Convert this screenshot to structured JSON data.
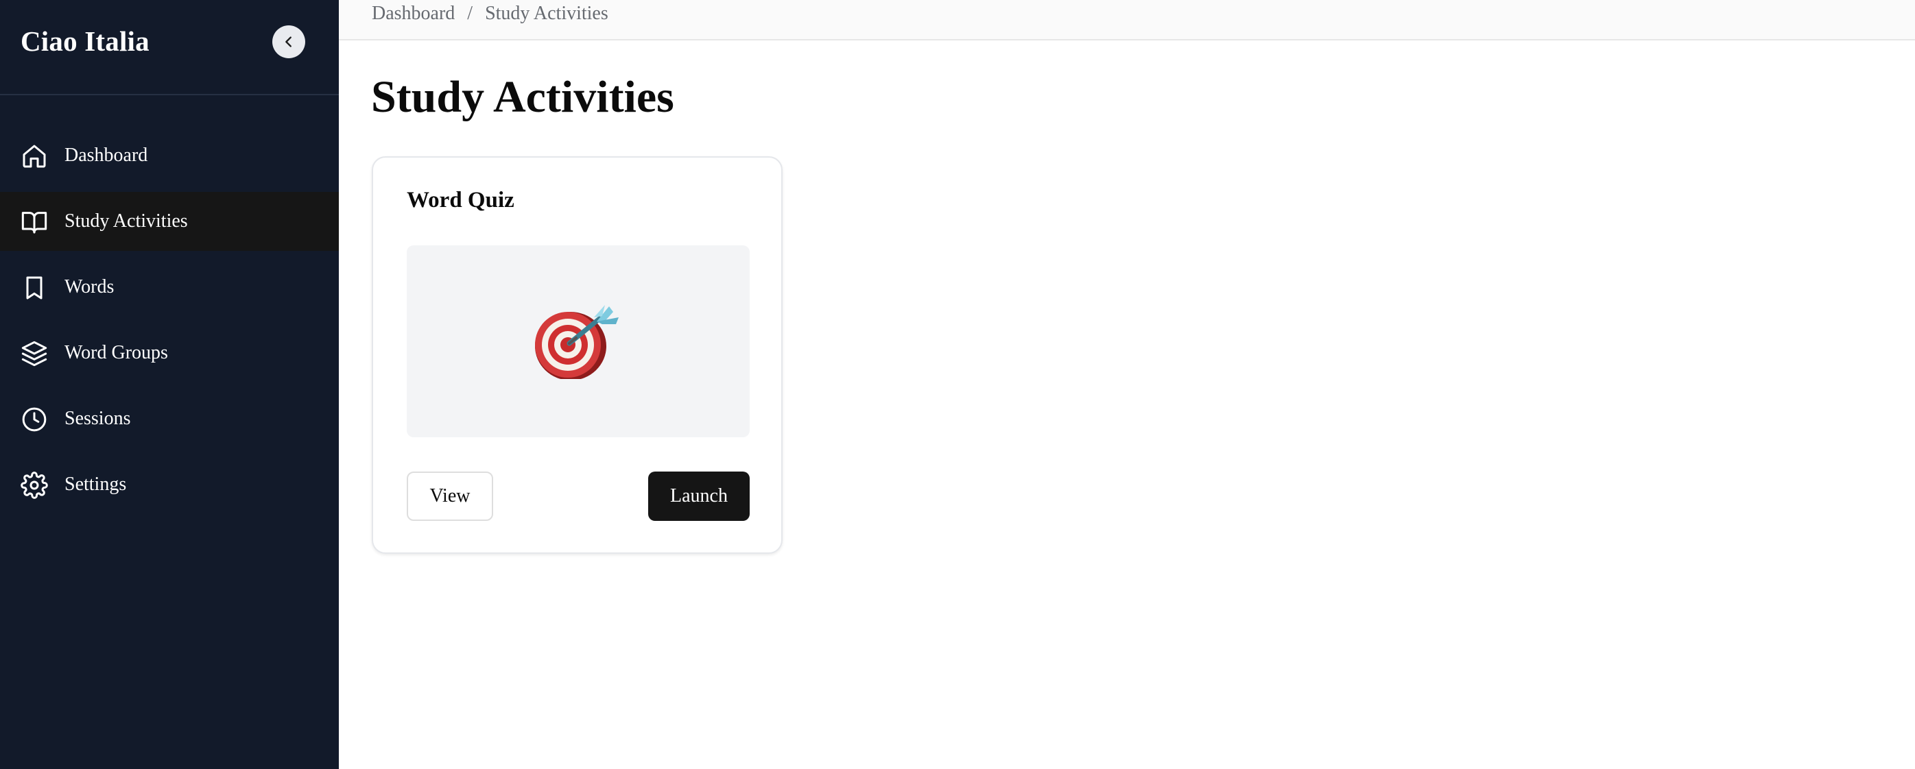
{
  "app": {
    "brand": "Ciao Italia"
  },
  "sidebar": {
    "items": [
      {
        "label": "Dashboard",
        "icon": "home-icon",
        "active": false
      },
      {
        "label": "Study Activities",
        "icon": "book-open-icon",
        "active": true
      },
      {
        "label": "Words",
        "icon": "bookmark-icon",
        "active": false
      },
      {
        "label": "Word Groups",
        "icon": "layers-icon",
        "active": false
      },
      {
        "label": "Sessions",
        "icon": "clock-icon",
        "active": false
      },
      {
        "label": "Settings",
        "icon": "gear-icon",
        "active": false
      }
    ],
    "collapse_icon": "chevron-left-icon"
  },
  "breadcrumb": {
    "items": [
      "Dashboard",
      "Study Activities"
    ],
    "separator": "/"
  },
  "page": {
    "title": "Study Activities"
  },
  "activities": [
    {
      "title": "Word Quiz",
      "thumbnail_icon": "dart-target-icon",
      "view_label": "View",
      "launch_label": "Launch"
    }
  ],
  "colors": {
    "sidebar_bg": "#121a2a",
    "active_item_bg": "#161616",
    "primary_button": "#151515"
  }
}
